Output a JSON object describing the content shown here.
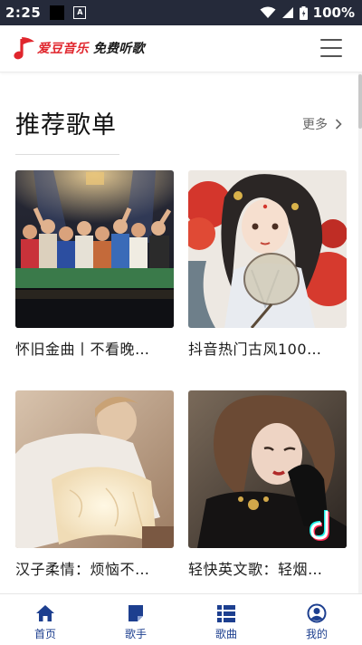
{
  "status_bar": {
    "time": "2:25",
    "battery": "100%",
    "icons": [
      "black-square-icon",
      "a-notification-icon",
      "wifi-icon",
      "signal-icon",
      "battery-icon"
    ]
  },
  "header": {
    "logo_brand": "爱豆音乐",
    "logo_slogan": " 免费听歌",
    "menu_icon": "hamburger-menu-icon"
  },
  "section": {
    "title": "推荐歌单",
    "more_label": "更多"
  },
  "playlists": [
    {
      "title": "怀旧金曲丨不看晚…"
    },
    {
      "title": "抖音热门古风100…"
    },
    {
      "title": "汉子柔情：烦恼不…"
    },
    {
      "title": "轻快英文歌：轻烟…"
    }
  ],
  "bottom_nav": [
    {
      "label": "首页",
      "icon": "home-icon"
    },
    {
      "label": "歌手",
      "icon": "singer-card-icon"
    },
    {
      "label": "歌曲",
      "icon": "song-list-icon"
    },
    {
      "label": "我的",
      "icon": "user-profile-icon"
    }
  ],
  "colors": {
    "status_bar_bg": "#252a3a",
    "nav_accent": "#1d3f8f",
    "brand_red": "#e0262d"
  }
}
